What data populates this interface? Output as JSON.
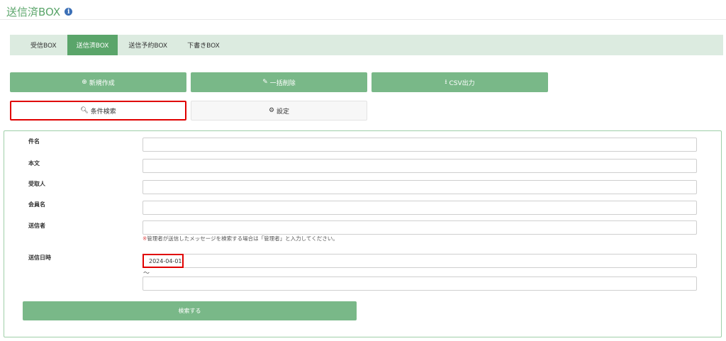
{
  "page": {
    "title": "送信済BOX",
    "info_icon": "i"
  },
  "tabs": [
    {
      "label": "受信BOX",
      "active": false
    },
    {
      "label": "送信済BOX",
      "active": true
    },
    {
      "label": "送信予約BOX",
      "active": false
    },
    {
      "label": "下書きBOX",
      "active": false
    }
  ],
  "actions": {
    "new_label": "新規作成",
    "bulk_delete_label": "一括削除",
    "csv_label": "CSV出力",
    "search_toggle_label": "条件検索",
    "settings_label": "設定"
  },
  "form": {
    "subject_label": "件名",
    "body_label": "本文",
    "recipient_label": "受取人",
    "member_label": "会員名",
    "sender_label": "送信者",
    "sender_note_mark": "※",
    "sender_note": "管理者が送信したメッセージを検索する場合は「管理者」と入力してください。",
    "date_label": "送信日時",
    "date_from_value": "2024-04-01",
    "date_to_value": "",
    "range_separator": "〜",
    "submit_label": "検索する"
  },
  "colors": {
    "accent": "#5aa56a",
    "button": "#79b888",
    "tab_bar": "#dcebe0",
    "highlight": "#e00000"
  }
}
